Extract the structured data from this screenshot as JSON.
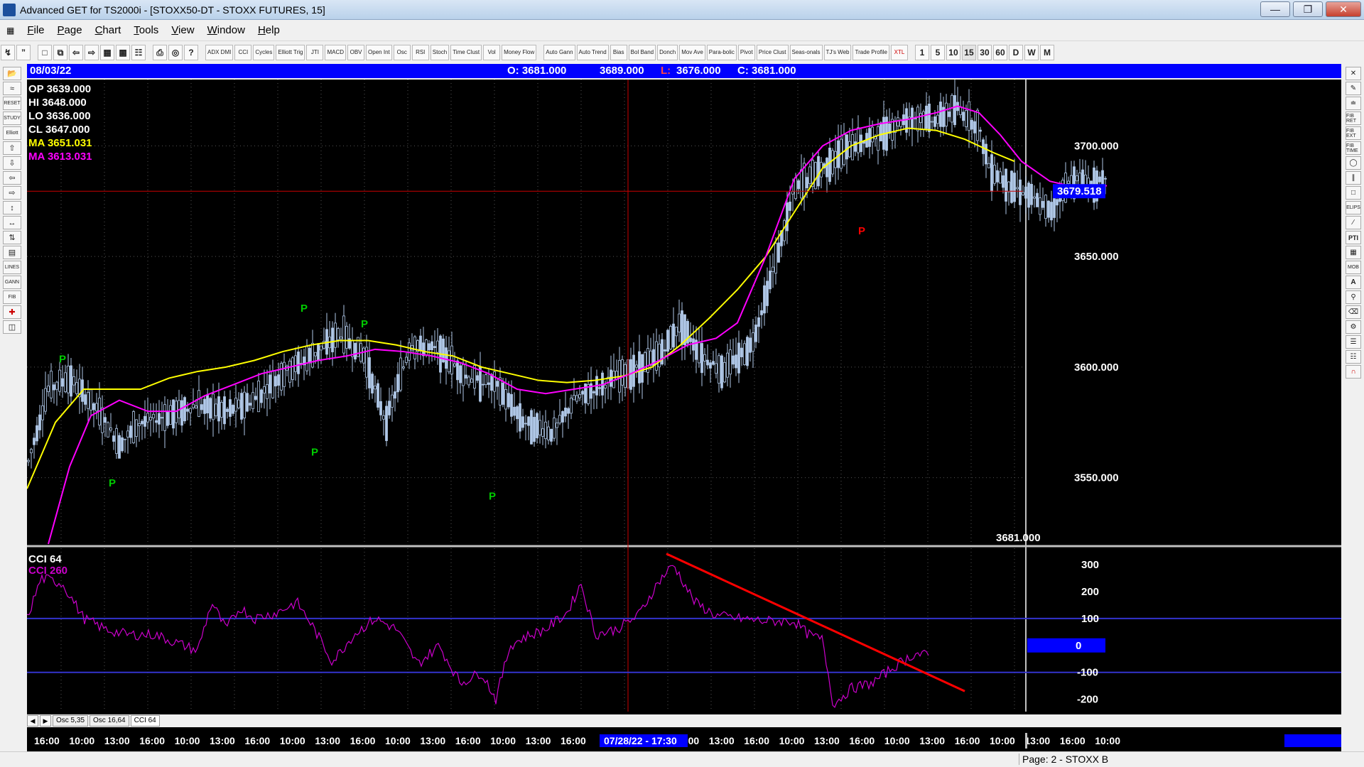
{
  "window": {
    "title": "Advanced GET for TS2000i - [STOXX50-DT - STOXX FUTURES, 15]"
  },
  "menu": [
    {
      "label": "File",
      "ul": "F",
      "rest": "ile"
    },
    {
      "label": "Page",
      "ul": "P",
      "rest": "age"
    },
    {
      "label": "Chart",
      "ul": "C",
      "rest": "hart"
    },
    {
      "label": "Tools",
      "ul": "T",
      "rest": "ools"
    },
    {
      "label": "View",
      "ul": "V",
      "rest": "iew"
    },
    {
      "label": "Window",
      "ul": "W",
      "rest": "indow"
    },
    {
      "label": "Help",
      "ul": "H",
      "rest": "elp"
    }
  ],
  "toolbar": {
    "study_buttons": [
      "ADX DMI",
      "CCI",
      "Cycles",
      "Elliott Trig",
      "JTI",
      "MACD",
      "OBV",
      "Open Int",
      "Osc",
      "RSI",
      "Stoch",
      "Time Clust",
      "Vol",
      "Money Flow"
    ],
    "overlay_buttons": [
      "Auto Gann",
      "Auto Trend",
      "Bias",
      "Bol Band",
      "Donch",
      "Mov Ave",
      "Para-bolic",
      "Pivot",
      "Price Clust",
      "Seas-onals",
      "TJ's Web",
      "Trade Profile",
      "XTL"
    ],
    "period_buttons": [
      "1",
      "5",
      "10",
      "15",
      "30",
      "60",
      "D",
      "W",
      "M"
    ]
  },
  "infobar": {
    "date": "08/03/22",
    "open": "O: 3681.000",
    "high": "3689.000",
    "low_label": "L:",
    "low": "3676.000",
    "close": "C: 3681.000"
  },
  "legend": {
    "op": "OP  3639.000",
    "hi": "HI   3648.000",
    "lo": "LO  3636.000",
    "cl": "CL  3647.000",
    "ma1": "MA  3651.031",
    "ma2": "MA  3613.031"
  },
  "colors": {
    "background": "#000000",
    "bars": "#b0c8e8",
    "ma_fast": "#ffff00",
    "ma_slow": "#ff00ff",
    "cursor": "#cc0000",
    "cci": "#cc00cc",
    "trendline": "#ff0000",
    "pivot_low": "#00cc00",
    "pivot_red": "#ff0000",
    "grid": "#555555",
    "bands": "#3333cc"
  },
  "price_panel": {
    "current_price_tag": "3679.518",
    "last_price": "3681.000",
    "pivot_label": "P"
  },
  "cci_panel": {
    "title1": "CCI 64",
    "title2": "CCI  260",
    "zero_tag": "0"
  },
  "tabs": [
    "Osc 5,35",
    "Osc 16,64",
    "CCI 64"
  ],
  "time_axis": {
    "labels": [
      "16:00",
      "10:00",
      "13:00",
      "16:00",
      "10:00",
      "13:00",
      "16:00",
      "10:00",
      "13:00",
      "16:00",
      "10:00",
      "13:00",
      "16:00",
      "10:00",
      "13:00",
      "16:00",
      "10:00",
      "13:00",
      "16:00",
      "10:00",
      "13:00",
      "16:00",
      "10:00",
      "13:00",
      "16:00",
      "10:00",
      "13:00",
      "16:00",
      "10:00"
    ],
    "cursor_label": "07/28/22 - 17:30"
  },
  "status": {
    "page": "Page: 2 - STOXX B"
  },
  "chart_data": [
    {
      "type": "candlestick",
      "title": "STOXX50-DT - STOXX FUTURES, 15",
      "y_ticks": [
        3550,
        3600,
        3650,
        3700
      ],
      "ylim": [
        3520,
        3730
      ],
      "current_price": 3679.518,
      "series": [
        {
          "name": "MA",
          "value": 3651.031
        },
        {
          "name": "MA",
          "value": 3613.031
        }
      ],
      "price_path": [
        [
          0,
          3555
        ],
        [
          30,
          3590
        ],
        [
          60,
          3595
        ],
        [
          100,
          3580
        ],
        [
          130,
          3565
        ],
        [
          160,
          3575
        ],
        [
          200,
          3578
        ],
        [
          240,
          3583
        ],
        [
          280,
          3580
        ],
        [
          320,
          3585
        ],
        [
          360,
          3597
        ],
        [
          400,
          3605
        ],
        [
          440,
          3615
        ],
        [
          475,
          3605
        ],
        [
          505,
          3575
        ],
        [
          540,
          3610
        ],
        [
          580,
          3608
        ],
        [
          620,
          3595
        ],
        [
          660,
          3592
        ],
        [
          700,
          3575
        ],
        [
          740,
          3570
        ],
        [
          770,
          3585
        ],
        [
          810,
          3592
        ],
        [
          850,
          3598
        ],
        [
          890,
          3605
        ],
        [
          920,
          3620
        ],
        [
          950,
          3605
        ],
        [
          980,
          3598
        ],
        [
          1020,
          3610
        ],
        [
          1060,
          3655
        ],
        [
          1080,
          3680
        ],
        [
          1120,
          3690
        ],
        [
          1160,
          3700
        ],
        [
          1200,
          3705
        ],
        [
          1240,
          3713
        ],
        [
          1280,
          3712
        ],
        [
          1310,
          3717
        ],
        [
          1340,
          3708
        ],
        [
          1355,
          3690
        ],
        [
          1380,
          3683
        ],
        [
          1410,
          3678
        ],
        [
          1440,
          3670
        ],
        [
          1470,
          3685
        ],
        [
          1500,
          3683
        ],
        [
          1520,
          3684
        ]
      ],
      "ma_fast_path": [
        [
          0,
          3545
        ],
        [
          40,
          3575
        ],
        [
          80,
          3590
        ],
        [
          120,
          3590
        ],
        [
          160,
          3590
        ],
        [
          200,
          3595
        ],
        [
          240,
          3598
        ],
        [
          280,
          3600
        ],
        [
          320,
          3603
        ],
        [
          360,
          3607
        ],
        [
          400,
          3610
        ],
        [
          440,
          3612
        ],
        [
          480,
          3612
        ],
        [
          520,
          3610
        ],
        [
          560,
          3607
        ],
        [
          600,
          3605
        ],
        [
          640,
          3600
        ],
        [
          680,
          3597
        ],
        [
          720,
          3594
        ],
        [
          760,
          3593
        ],
        [
          800,
          3594
        ],
        [
          840,
          3596
        ],
        [
          880,
          3600
        ],
        [
          920,
          3610
        ],
        [
          960,
          3622
        ],
        [
          1000,
          3635
        ],
        [
          1040,
          3650
        ],
        [
          1080,
          3670
        ],
        [
          1120,
          3690
        ],
        [
          1160,
          3700
        ],
        [
          1200,
          3705
        ],
        [
          1240,
          3708
        ],
        [
          1280,
          3707
        ],
        [
          1320,
          3703
        ],
        [
          1360,
          3697
        ],
        [
          1390,
          3693
        ]
      ],
      "ma_slow_path": [
        [
          30,
          3520
        ],
        [
          60,
          3555
        ],
        [
          90,
          3578
        ],
        [
          130,
          3585
        ],
        [
          170,
          3580
        ],
        [
          210,
          3580
        ],
        [
          250,
          3587
        ],
        [
          290,
          3592
        ],
        [
          330,
          3597
        ],
        [
          370,
          3600
        ],
        [
          410,
          3603
        ],
        [
          450,
          3605
        ],
        [
          490,
          3608
        ],
        [
          530,
          3607
        ],
        [
          570,
          3605
        ],
        [
          610,
          3602
        ],
        [
          650,
          3597
        ],
        [
          690,
          3590
        ],
        [
          730,
          3588
        ],
        [
          770,
          3590
        ],
        [
          810,
          3592
        ],
        [
          850,
          3597
        ],
        [
          890,
          3603
        ],
        [
          930,
          3610
        ],
        [
          970,
          3613
        ],
        [
          1000,
          3620
        ],
        [
          1040,
          3650
        ],
        [
          1080,
          3685
        ],
        [
          1120,
          3700
        ],
        [
          1160,
          3707
        ],
        [
          1200,
          3710
        ],
        [
          1240,
          3712
        ],
        [
          1280,
          3715
        ],
        [
          1310,
          3718
        ],
        [
          1340,
          3715
        ],
        [
          1370,
          3705
        ],
        [
          1400,
          3693
        ],
        [
          1440,
          3684
        ],
        [
          1480,
          3681
        ],
        [
          1520,
          3682
        ]
      ],
      "pivots": [
        {
          "x": 50,
          "price": 3602,
          "color": "green"
        },
        {
          "x": 120,
          "price": 3546,
          "color": "green"
        },
        {
          "x": 390,
          "price": 3625,
          "color": "green"
        },
        {
          "x": 405,
          "price": 3560,
          "color": "green"
        },
        {
          "x": 475,
          "price": 3618,
          "color": "green"
        },
        {
          "x": 655,
          "price": 3540,
          "color": "green"
        },
        {
          "x": 1175,
          "price": 3660,
          "color": "red"
        }
      ]
    },
    {
      "type": "line",
      "title": "CCI 64",
      "y_ticks": [
        -200,
        -100,
        0,
        100,
        200,
        300
      ],
      "ylim": [
        -230,
        350
      ],
      "bands": [
        100,
        -100
      ],
      "cci_path": [
        [
          0,
          100
        ],
        [
          20,
          250
        ],
        [
          50,
          230
        ],
        [
          80,
          100
        ],
        [
          110,
          60
        ],
        [
          140,
          40
        ],
        [
          180,
          40
        ],
        [
          200,
          20
        ],
        [
          240,
          -20
        ],
        [
          260,
          160
        ],
        [
          280,
          60
        ],
        [
          300,
          140
        ],
        [
          320,
          100
        ],
        [
          350,
          120
        ],
        [
          380,
          160
        ],
        [
          400,
          80
        ],
        [
          430,
          -60
        ],
        [
          460,
          40
        ],
        [
          490,
          100
        ],
        [
          520,
          60
        ],
        [
          550,
          -70
        ],
        [
          580,
          0
        ],
        [
          610,
          -140
        ],
        [
          640,
          -100
        ],
        [
          660,
          -200
        ],
        [
          680,
          0
        ],
        [
          700,
          30
        ],
        [
          730,
          60
        ],
        [
          760,
          120
        ],
        [
          780,
          230
        ],
        [
          800,
          40
        ],
        [
          830,
          60
        ],
        [
          860,
          110
        ],
        [
          890,
          240
        ],
        [
          910,
          300
        ],
        [
          940,
          160
        ],
        [
          970,
          110
        ],
        [
          1000,
          100
        ],
        [
          1040,
          90
        ],
        [
          1080,
          90
        ],
        [
          1100,
          40
        ],
        [
          1120,
          20
        ],
        [
          1135,
          -220
        ],
        [
          1160,
          -160
        ],
        [
          1190,
          -140
        ],
        [
          1220,
          -80
        ],
        [
          1250,
          -30
        ],
        [
          1270,
          -40
        ]
      ],
      "trendline": [
        [
          900,
          340
        ],
        [
          1320,
          -170
        ]
      ]
    }
  ]
}
